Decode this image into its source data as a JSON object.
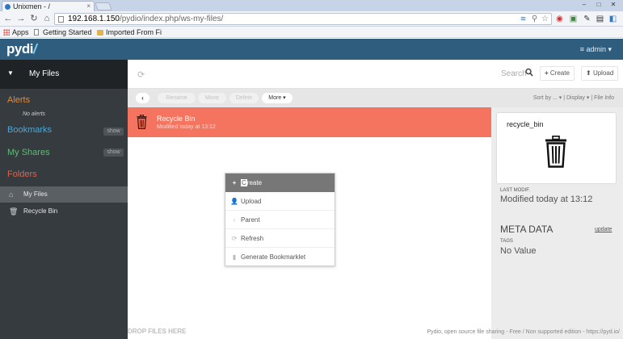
{
  "browser": {
    "tab_title": "Unixmen - /",
    "url_host": "192.168.1.150",
    "url_path": "/pydio/index.php/ws-my-files/",
    "bookmarks": [
      "Apps",
      "Getting Started",
      "Imported From Fi"
    ],
    "tab_close": "×",
    "win_min": "–",
    "win_max": "□",
    "win_close": "✕"
  },
  "app": {
    "logo_text": "pydi",
    "logo_accent": "/",
    "user_menu": "≡ admin ▾"
  },
  "sidebar": {
    "workspace_title": "My Files",
    "alerts_label": "Alerts",
    "no_alerts": "No alerts",
    "bookmarks_label": "Bookmarks",
    "bookmarks_show": "show",
    "shares_label": "My Shares",
    "shares_show": "show",
    "folders_label": "Folders",
    "folders": [
      {
        "label": "My Files"
      },
      {
        "label": "Recycle Bin"
      }
    ]
  },
  "toolbar": {
    "search_label": "Search",
    "create_label": "Create",
    "upload_label": "Upload",
    "actions": [
      "Rename",
      "Move",
      "Delete"
    ],
    "more_label": "More ▾",
    "view_options": "Sort by ... ▾  |  Display ▾  |  File Info"
  },
  "files": [
    {
      "name": "Recycle Bin",
      "meta": "Modified today at 13:12"
    }
  ],
  "context_menu": {
    "items": [
      {
        "prefix": "C",
        "label": "reate",
        "icon": "+"
      },
      {
        "label": "Upload",
        "icon": "👤"
      },
      {
        "label": "Parent",
        "icon": "‹"
      },
      {
        "label": "Refresh",
        "icon": "⟳"
      },
      {
        "label": "Generate Bookmarklet",
        "icon": "▮"
      }
    ]
  },
  "drop_hint": "DROP FILES HERE",
  "info_panel": {
    "preview_title": "recycle_bin",
    "last_modif_label": "LAST MODIF.",
    "last_modif_value": "Modified today at 13:12",
    "meta_title": "META DATA",
    "meta_update": "update",
    "tags_label": "TAGS",
    "tags_value": "No Value"
  },
  "footer": "Pydio, open source file sharing - Free / Non supported edition - https://pyd.io/",
  "colors": {
    "header": "#2e5d7d",
    "selected_row": "#f57460",
    "sidebar_bg": "#363b3f"
  }
}
